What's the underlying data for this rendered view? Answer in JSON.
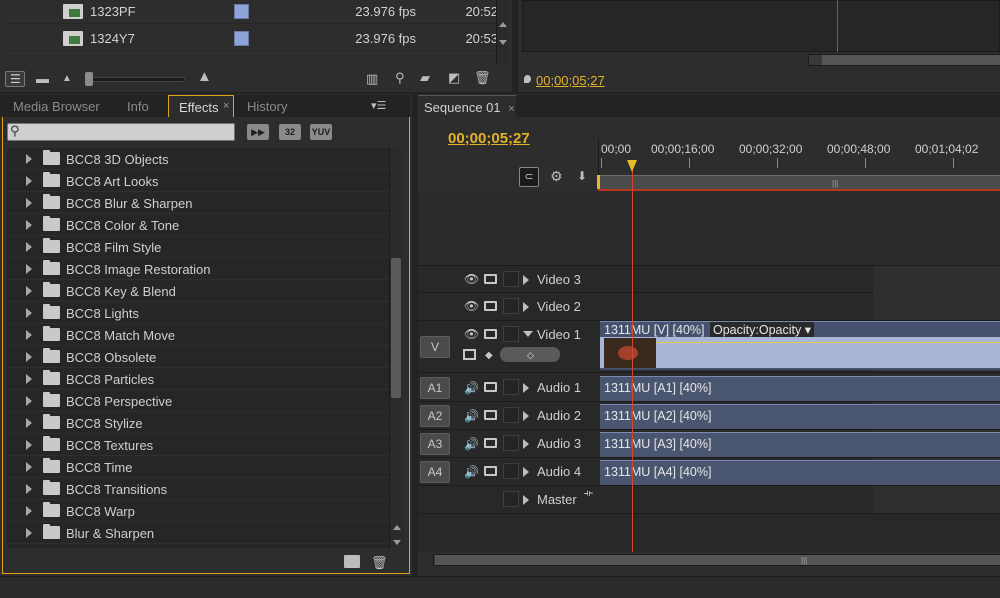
{
  "project": {
    "rows": [
      {
        "name": "1323PF",
        "fps": "23.976 fps",
        "duration": "20:52"
      },
      {
        "name": "1324Y7",
        "fps": "23.976 fps",
        "duration": "20:53"
      }
    ]
  },
  "program_monitor": {
    "timecode": "00;00;05;27"
  },
  "effects_panel": {
    "tabs": [
      {
        "label": "Media Browser",
        "active": false
      },
      {
        "label": "Info",
        "active": false
      },
      {
        "label": "Effects",
        "active": true
      },
      {
        "label": "History",
        "active": false
      }
    ],
    "search_placeholder": "",
    "filter_buttons": [
      "32",
      "YUV"
    ],
    "items": [
      "BCC8 3D Objects",
      "BCC8 Art Looks",
      "BCC8 Blur & Sharpen",
      "BCC8 Color & Tone",
      "BCC8 Film Style",
      "BCC8 Image Restoration",
      "BCC8 Key & Blend",
      "BCC8 Lights",
      "BCC8 Match Move",
      "BCC8 Obsolete",
      "BCC8 Particles",
      "BCC8 Perspective",
      "BCC8 Stylize",
      "BCC8 Textures",
      "BCC8 Time",
      "BCC8 Transitions",
      "BCC8 Warp",
      "Blur & Sharpen"
    ]
  },
  "timeline": {
    "tab_label": "Sequence 01",
    "timecode": "00;00;05;27",
    "ruler_labels": [
      "00;00",
      "00;00;16;00",
      "00;00;32;00",
      "00;00;48;00",
      "00;01;04;02"
    ],
    "source_patch_video": "V",
    "tracks": {
      "video3": "Video 3",
      "video2": "Video 2",
      "video1": "Video 1",
      "audio1": {
        "patch": "A1",
        "name": "Audio 1"
      },
      "audio2": {
        "patch": "A2",
        "name": "Audio 2"
      },
      "audio3": {
        "patch": "A3",
        "name": "Audio 3"
      },
      "audio4": {
        "patch": "A4",
        "name": "Audio 4"
      },
      "master": "Master"
    },
    "clips": {
      "video1": "1311MU [V] [40%]",
      "opacity_menu": "Opacity:Opacity",
      "audio1": "1311MU [A1] [40%]",
      "audio2": "1311MU [A2] [40%]",
      "audio3": "1311MU [A3] [40%]",
      "audio4": "1311MU [A4] [40%]"
    }
  },
  "colors": {
    "accent_timecode": "#e3b22a",
    "playhead": "#d0492e",
    "clip_blue": "#4a5670",
    "panel_bg": "#2d2d2d"
  }
}
